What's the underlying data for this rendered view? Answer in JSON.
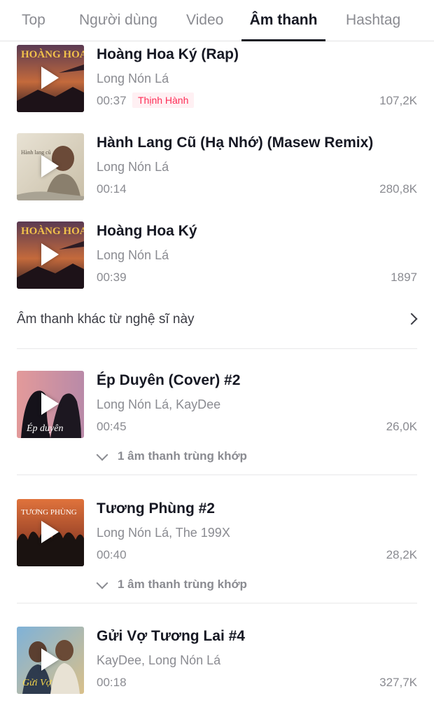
{
  "tabs": [
    {
      "label": "Top",
      "active": false
    },
    {
      "label": "Người dùng",
      "active": false
    },
    {
      "label": "Video",
      "active": false
    },
    {
      "label": "Âm thanh",
      "active": true
    },
    {
      "label": "Hashtag",
      "active": false
    }
  ],
  "sounds": [
    {
      "title": "Hoàng Hoa Ký (Rap)",
      "artist": "Long Nón Lá",
      "duration": "00:37",
      "badge": "Thịnh Hành",
      "count": "107,2K",
      "cover_text": "HOÀNG HOA"
    },
    {
      "title": "Hành Lang Cũ (Hạ Nhớ) (Masew Remix)",
      "artist": "Long Nón Lá",
      "duration": "00:14",
      "count": "280,8K",
      "cover_text": "Hành lang cũ"
    },
    {
      "title": "Hoàng Hoa Ký",
      "artist": "Long Nón Lá",
      "duration": "00:39",
      "count": "1897",
      "cover_text": "HOÀNG HOA"
    }
  ],
  "more_from_artist": "Âm thanh khác từ nghệ sĩ này",
  "related_sounds": [
    {
      "title": "Ép Duyên (Cover) #2",
      "artist": "Long Nón Lá, KayDee",
      "duration": "00:45",
      "count": "26,0K",
      "match": "1 âm thanh trùng khớp",
      "cover_text": "Ép duyên"
    },
    {
      "title": "Tương Phùng #2",
      "artist": "Long Nón Lá, The 199X",
      "duration": "00:40",
      "count": "28,2K",
      "match": "1 âm thanh trùng khớp",
      "cover_text": "TƯƠNG PHÙNG"
    },
    {
      "title": "Gửi Vợ Tương Lai #4",
      "artist": "KayDee, Long Nón Lá",
      "duration": "00:18",
      "count": "327,7K",
      "cover_text": "Gửi Vợ"
    }
  ],
  "colors": {
    "accent": "#fe2c55",
    "text_primary": "#161823",
    "text_secondary": "#8a8b91"
  },
  "icons": {
    "play": "play-icon",
    "expand": "chevron-down-icon",
    "more": "chevron-right-icon"
  }
}
